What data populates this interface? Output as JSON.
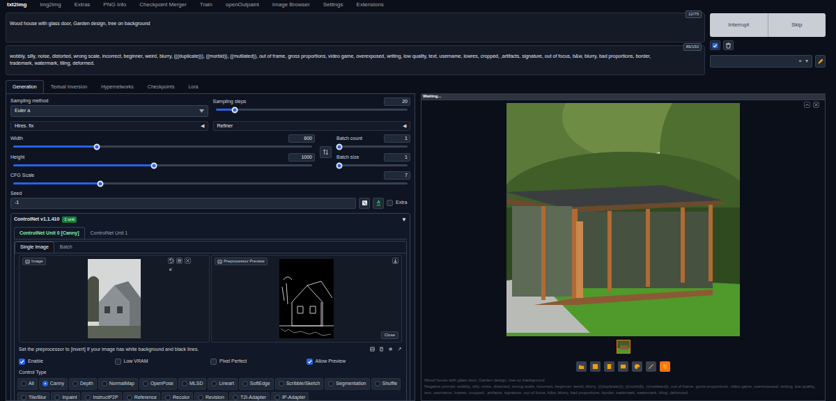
{
  "top_tabs": [
    {
      "label": "txt2img",
      "selected": true
    },
    {
      "label": "img2img",
      "selected": false
    },
    {
      "label": "Extras",
      "selected": false
    },
    {
      "label": "PNG Info",
      "selected": false
    },
    {
      "label": "Checkpoint Merger",
      "selected": false
    },
    {
      "label": "Train",
      "selected": false
    },
    {
      "label": "openOutpaint",
      "selected": false
    },
    {
      "label": "Image Browser",
      "selected": false
    },
    {
      "label": "Settings",
      "selected": false
    },
    {
      "label": "Extensions",
      "selected": false
    }
  ],
  "prompt": {
    "text": "Wood house with glass door, Garden design, tree on background",
    "counter": "12/75"
  },
  "negative_prompt": {
    "text": "wobbly, silly, noise, distorted, wrong scale, incorrect, beginner, weird, blurry, (((duplicate))), ((morbid)), ((mutilated)), out of frame, gross proportions, video game, overexposed, writing, low quality, text, username, lowres, cropped, ,artifacts, signature, out of focus, b&w, blurry, bad proportions, border, trademark, watermark, tiling, deformed.",
    "counter": "89/150"
  },
  "buttons": {
    "interrupt": "Interrupt",
    "skip": "Skip"
  },
  "styles": {
    "clear": "×",
    "open": "▾"
  },
  "generation_tabs": [
    {
      "label": "Generation",
      "selected": true
    },
    {
      "label": "Textual Inversion",
      "selected": false
    },
    {
      "label": "Hypernetworks",
      "selected": false
    },
    {
      "label": "Checkpoints",
      "selected": false
    },
    {
      "label": "Lora",
      "selected": false
    }
  ],
  "sampling_method": {
    "label": "Sampling method",
    "value": "Euler a"
  },
  "sampling_steps": {
    "label": "Sampling steps",
    "value": "20",
    "level": 0.1
  },
  "accordions": [
    {
      "label": "Hires. fix",
      "toggle": "◀"
    },
    {
      "label": "Refiner",
      "toggle": "◀"
    }
  ],
  "width": {
    "label": "Width",
    "value": "600",
    "level": 0.28
  },
  "height": {
    "label": "Height",
    "value": "1000",
    "level": 0.47
  },
  "batch_count": {
    "label": "Batch count",
    "value": "1",
    "level": 0
  },
  "batch_size": {
    "label": "Batch size",
    "value": "1",
    "level": 0
  },
  "cfg_scale": {
    "label": "CFG Scale",
    "value": "7",
    "level": 0.22
  },
  "seed": {
    "label": "Seed",
    "value": "-1"
  },
  "extra": {
    "label": "Extra",
    "checked": false
  },
  "controlnet": {
    "title": "ControlNet v1.1.410",
    "badge": "1 unit",
    "toggle": "▼",
    "units": [
      {
        "label": "ControlNet Unit 0 [Canny]",
        "selected": true
      },
      {
        "label": "ControlNet Unit 1",
        "selected": false
      }
    ],
    "image_tabs": [
      {
        "label": "Single Image",
        "selected": true
      },
      {
        "label": "Batch",
        "selected": false
      }
    ],
    "image_label": "Image",
    "preview_label": "Preprocessor Preview",
    "close": "Close",
    "hint": "Set the preprocessor to [invert] If your image has white background and black lines.",
    "options": [
      {
        "label": "Enable",
        "checked": true
      },
      {
        "label": "Low VRAM",
        "checked": false
      },
      {
        "label": "Pixel Perfect",
        "checked": false
      },
      {
        "label": "Allow Preview",
        "checked": true
      }
    ],
    "control_type_label": "Control Type",
    "control_type_rows": [
      [
        {
          "label": "All",
          "selected": false
        },
        {
          "label": "Canny",
          "selected": true
        },
        {
          "label": "Depth",
          "selected": false
        },
        {
          "label": "NormalMap",
          "selected": false
        },
        {
          "label": "OpenPose",
          "selected": false
        },
        {
          "label": "MLSD",
          "selected": false
        },
        {
          "label": "Lineart",
          "selected": false
        },
        {
          "label": "SoftEdge",
          "selected": false
        },
        {
          "label": "Scribble/Sketch",
          "selected": false
        },
        {
          "label": "Segmentation",
          "selected": false
        },
        {
          "label": "Shuffle",
          "selected": false
        }
      ],
      [
        {
          "label": "Tile/Blur",
          "selected": false
        },
        {
          "label": "Inpaint",
          "selected": false
        },
        {
          "label": "InstructP2P",
          "selected": false
        },
        {
          "label": "Reference",
          "selected": false
        },
        {
          "label": "Recolor",
          "selected": false
        },
        {
          "label": "Revision",
          "selected": false
        },
        {
          "label": "T2I-Adapter",
          "selected": false
        },
        {
          "label": "IP-Adapter",
          "selected": false
        }
      ]
    ]
  },
  "output": {
    "status": "Waiting...",
    "info_prompt": "Wood house with glass door, Garden design, tree on background",
    "info_negative": "Negative prompt: wobbly, silly, noise, distorted, wrong scale, incorrect, beginner, weird, blurry, (((duplicate))), ((morbid)), ((mutilated)), out of frame, gross proportions, video game, overexposed, writing, low quality, text, username, lowres, cropped, ,artifacts, signature, out of focus, b&w, blurry, bad proportions, border, trademark, watermark, tiling, deformed."
  }
}
